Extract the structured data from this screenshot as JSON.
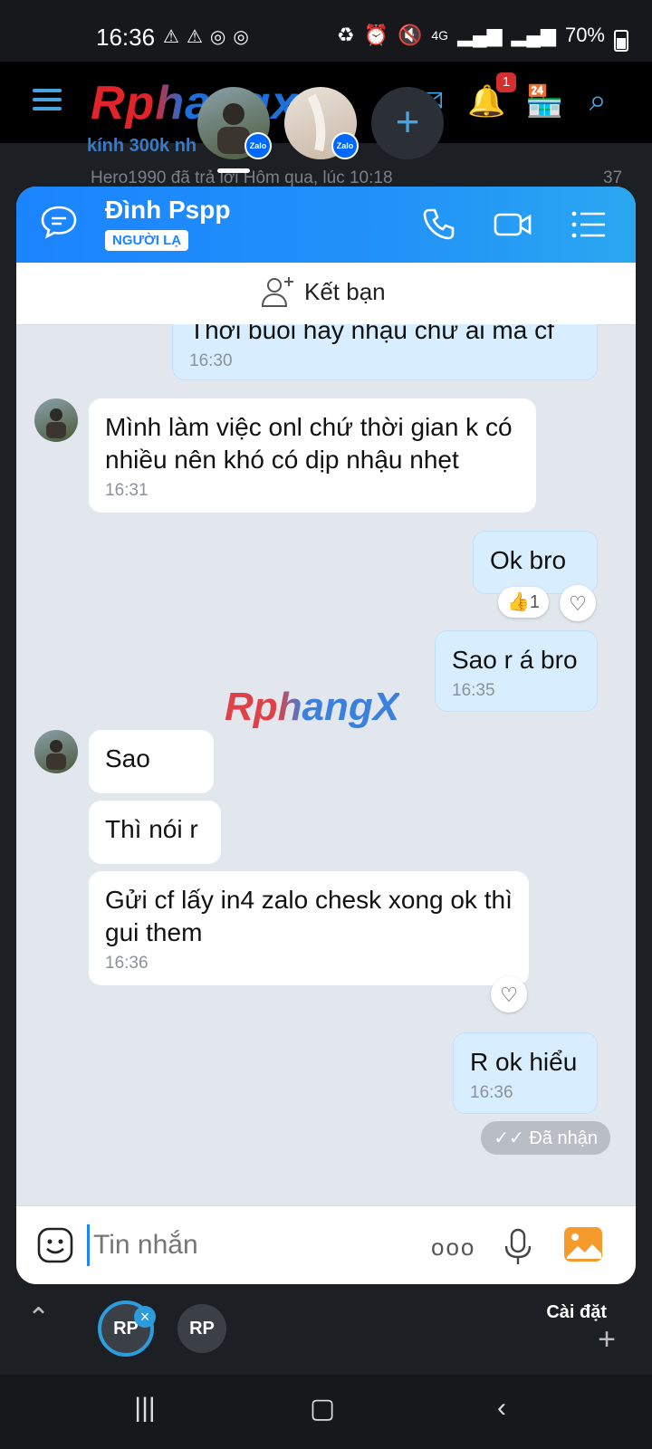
{
  "status_bar": {
    "time": "16:36",
    "network": "4G",
    "battery": "70%",
    "battery_level": 0.7
  },
  "background_app": {
    "logo": "Rphangx",
    "notification_count": "1",
    "thread_title": "kính 300k nh",
    "thread_reply": "Hero1990 đã trả lời Hôm qua, lúc 10:18",
    "thread_count": "37"
  },
  "floating_bubbles": {
    "badge_label": "Zalo"
  },
  "chat": {
    "contact_name": "Đình Pspp",
    "stranger_badge": "NGƯỜI LẠ",
    "add_friend_label": "Kết bạn",
    "watermark": "RphangX",
    "messages": [
      {
        "direction": "out",
        "text": "Thời buổi hay nhậu chứ ai mà cf",
        "time": "16:30"
      },
      {
        "direction": "in",
        "text": "Mình làm việc onl chứ thời gian k có nhiều nên khó có dịp nhậu nhẹt",
        "time": "16:31"
      },
      {
        "direction": "out",
        "text": "Ok bro",
        "reaction_like_count": "1"
      },
      {
        "direction": "out",
        "text": "Sao r á bro",
        "time": "16:35"
      },
      {
        "direction": "in",
        "text": "Sao"
      },
      {
        "direction": "in",
        "text": "Thì nói r"
      },
      {
        "direction": "in",
        "text": "Gửi cf lấy in4 zalo chesk xong ok thì gui them",
        "time": "16:36"
      },
      {
        "direction": "out",
        "text": "R ok hiểu",
        "time": "16:36"
      }
    ],
    "received_status": "Đã nhận",
    "composer_placeholder": "Tin nhắn",
    "more_label": "ooo"
  },
  "tray": {
    "bubble_label": "RP",
    "settings_label": "Cài đặt"
  },
  "colors": {
    "header_blue": "#1b84ff",
    "outgoing_bubble": "#d8eeff",
    "incoming_bubble": "#ffffff",
    "chat_background": "#e2e7ee"
  }
}
